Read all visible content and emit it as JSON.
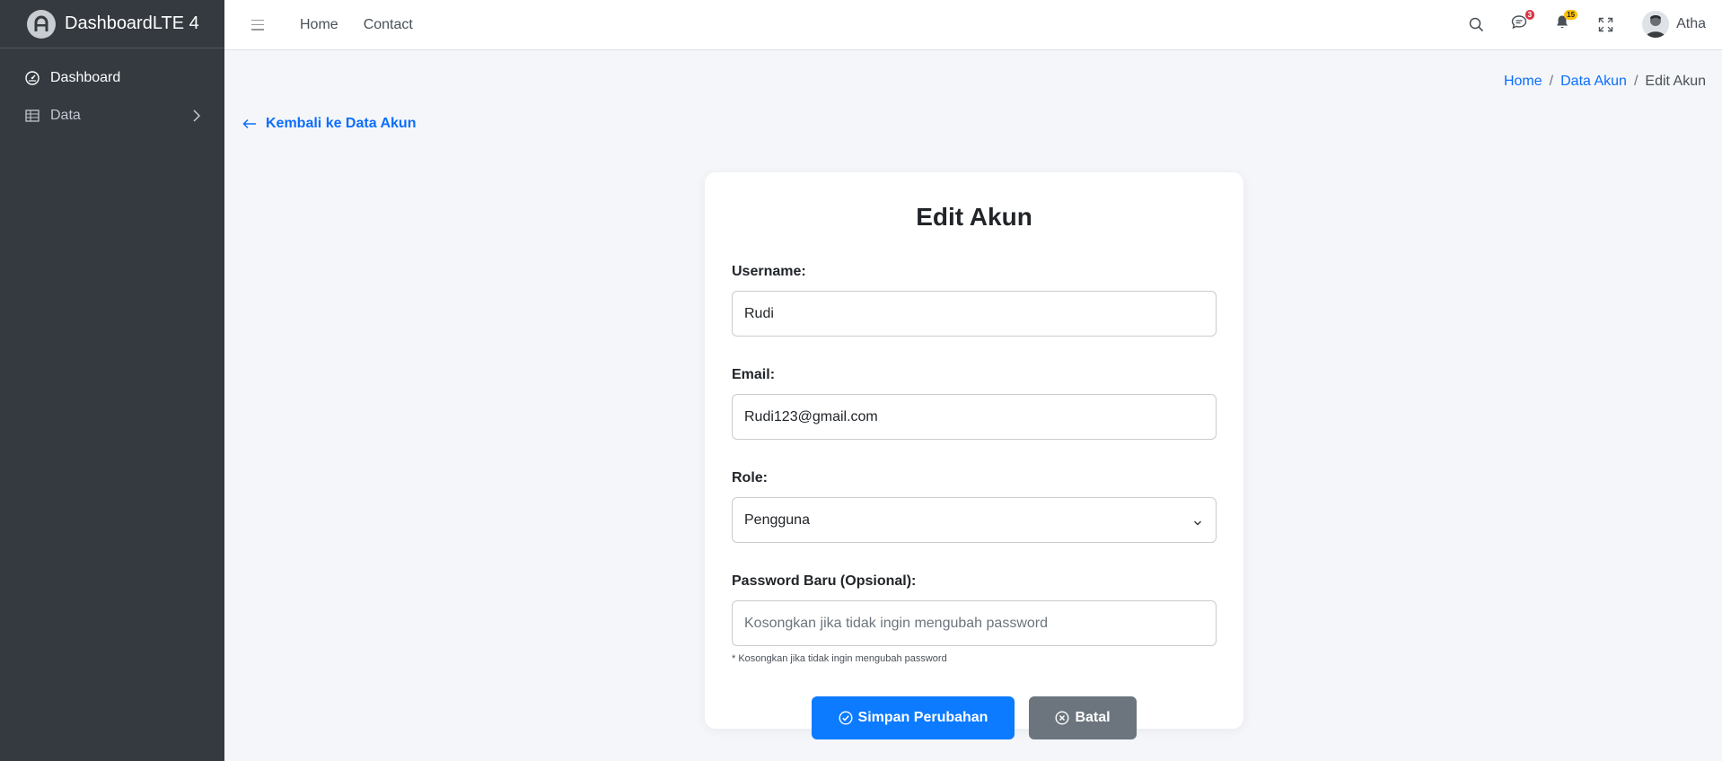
{
  "brand": {
    "name": "DashboardLTE 4"
  },
  "sidebar": {
    "items": [
      {
        "label": "Dashboard",
        "icon": "speedometer-icon"
      },
      {
        "label": "Data",
        "icon": "table-icon"
      }
    ]
  },
  "topbar": {
    "links": [
      "Home",
      "Contact"
    ],
    "messages_count": "3",
    "notifications_count": "15",
    "user_name": "Atha"
  },
  "breadcrumb": {
    "home": "Home",
    "parent": "Data Akun",
    "current": "Edit Akun",
    "separator": "/"
  },
  "back_link": "Kembali ke Data Akun",
  "form": {
    "title": "Edit Akun",
    "username": {
      "label": "Username:",
      "value": "Rudi"
    },
    "email": {
      "label": "Email:",
      "value": "Rudi123@gmail.com"
    },
    "role": {
      "label": "Role:",
      "selected": "Pengguna"
    },
    "password": {
      "label": "Password Baru (Opsional):",
      "placeholder": "Kosongkan jika tidak ingin mengubah password",
      "help": "* Kosongkan jika tidak ingin mengubah password"
    },
    "save_label": "Simpan Perubahan",
    "cancel_label": "Batal"
  },
  "colors": {
    "sidebar_bg": "#343a40",
    "primary": "#0d7bff",
    "secondary": "#6c757d",
    "page_bg": "#f4f6f9"
  }
}
